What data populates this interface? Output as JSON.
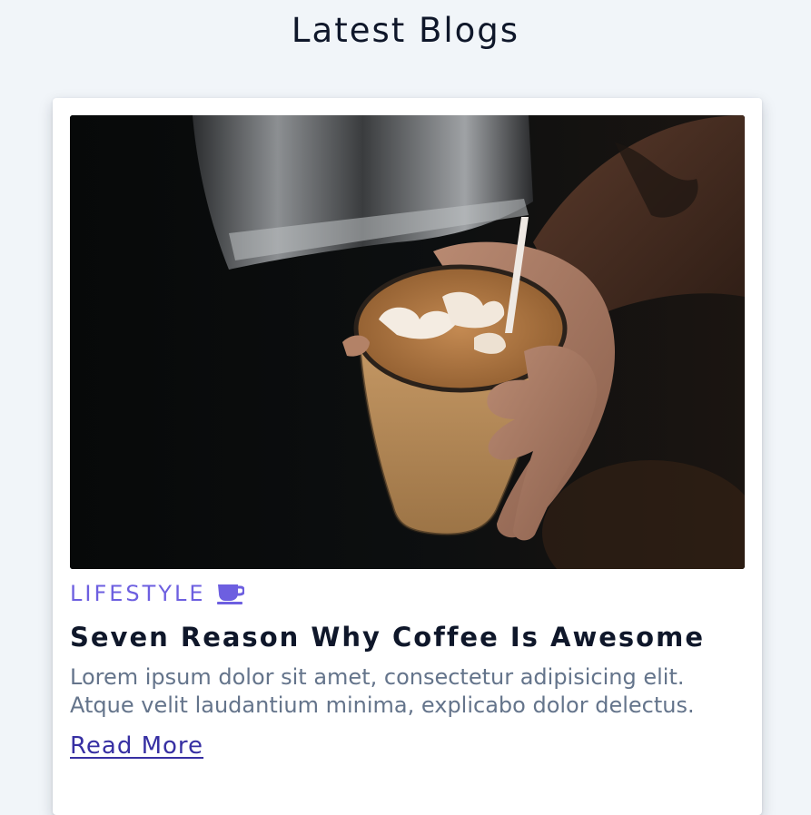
{
  "page": {
    "title": "Latest Blogs"
  },
  "post": {
    "category": "LIFESTYLE",
    "category_icon": "coffee-cup-icon",
    "title": "Seven Reason Why Coffee Is Awesome",
    "excerpt": "Lorem ipsum dolor sit amet, consectetur adipisicing elit. Atque velit laudantium minima, explicabo dolor delectus.",
    "read_more_label": "Read More",
    "image_alt": "coffee latte art"
  },
  "colors": {
    "background": "#f1f5f9",
    "accent": "#6d5fe0",
    "link": "#3730a3",
    "heading": "#0f172a",
    "muted_text": "#64748b"
  }
}
